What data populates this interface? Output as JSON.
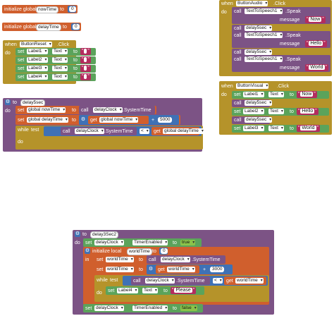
{
  "globals": {
    "init_label": "initialize global",
    "to_label": "to",
    "now_time": {
      "name": "nowTime",
      "value": "0"
    },
    "delay_time": {
      "name": "delayTime",
      "value": "0"
    }
  },
  "button_reset": {
    "when": "when",
    "component": "ButtonReset",
    "event": ".Click",
    "do": "do",
    "set": "set",
    "prop": "Text",
    "to": "to",
    "labels": [
      "Label1",
      "Label2",
      "Label3",
      "Label4"
    ]
  },
  "delay5sec": {
    "to": "to",
    "name": "delay5sec",
    "do": "do",
    "set": "set",
    "to2": "to",
    "call": "call",
    "global_now": "global nowTime",
    "global_delay": "global delayTime",
    "clock": "delayClock",
    "system_time": ".SystemTime",
    "get": "get",
    "plus": "+",
    "amount": "5000",
    "while": "while",
    "test": "test",
    "lt": "<",
    "do2": "do"
  },
  "button_audio": {
    "when": "when",
    "component": "ButtonAudio",
    "event": ".Click",
    "do": "do",
    "call": "call",
    "tts": "TextToSpeech1",
    "speak": ".Speak",
    "message": "message",
    "delay": "delay5sec",
    "words": [
      "Now",
      "Hello",
      "World"
    ]
  },
  "button_visual": {
    "when": "when",
    "component": "ButtonVisual",
    "event": ".Click",
    "do": "do",
    "set": "set",
    "prop": "Text",
    "to": "to",
    "call": "call",
    "delay": "delay5sec",
    "rows": [
      {
        "label": "Label1",
        "value": "Now"
      },
      {
        "label": "Label2",
        "value": "Hello"
      },
      {
        "label": "Label3",
        "value": "World"
      }
    ]
  },
  "delay3sec2": {
    "to": "to",
    "name": "delay3Sec2",
    "do": "do",
    "set": "set",
    "clock": "delayClock",
    "timer_enabled": "TimerEnabled",
    "to2": "to",
    "true": "true",
    "false": "false",
    "init_local": "initialize local",
    "world_time": "worldTime",
    "zero": "0",
    "in": "in",
    "call": "call",
    "system_time": ".SystemTime",
    "get": "get",
    "plus": "+",
    "amount": "3000",
    "while": "while",
    "test": "test",
    "lt": "<",
    "do2": "do",
    "label4": "Label4",
    "text": "Text",
    "please": "Please"
  }
}
